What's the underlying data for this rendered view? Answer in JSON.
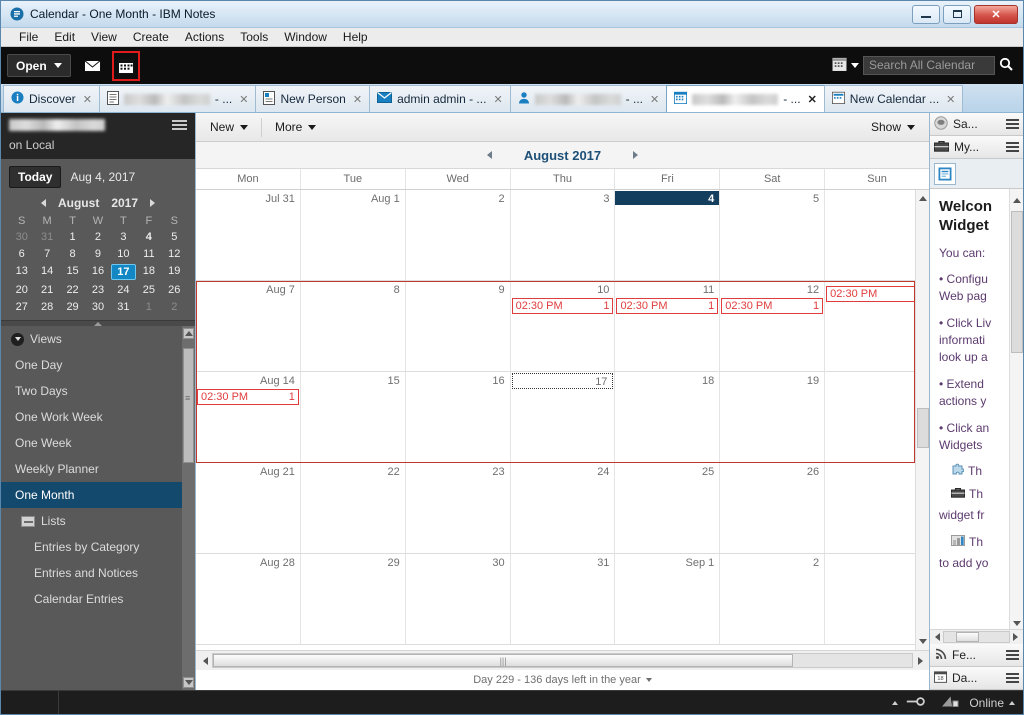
{
  "window": {
    "title": "Calendar - One Month - IBM Notes",
    "app_icon": "notes-logo-icon",
    "minimize_label": "Minimize",
    "maximize_label": "Maximize",
    "close_label": "✕"
  },
  "menubar": [
    "File",
    "Edit",
    "View",
    "Create",
    "Actions",
    "Tools",
    "Window",
    "Help"
  ],
  "toolbar": {
    "open_label": "Open",
    "mail_icon": "envelope-icon",
    "calendar_icon": "calendar-icon",
    "search_scope_icon": "calendar-icon",
    "search_placeholder": "Search All Calendar",
    "search_value": "",
    "search_icon": "magnifier-icon"
  },
  "tabs": [
    {
      "label": "Discover",
      "icon": "info-icon",
      "redacted": false,
      "active": false,
      "close": "✕"
    },
    {
      "label": "",
      "suffix": "- ...",
      "icon": "document-icon",
      "redacted": true,
      "active": false,
      "close": "✕"
    },
    {
      "label": "New Person",
      "icon": "person-document-icon",
      "redacted": false,
      "active": false,
      "close": "✕"
    },
    {
      "label": "admin admin - ...",
      "icon": "mail-icon",
      "redacted": false,
      "active": false,
      "close": "✕"
    },
    {
      "label": "",
      "suffix": "- ...",
      "icon": "contact-icon",
      "redacted": true,
      "active": false,
      "close": "✕"
    },
    {
      "label": "",
      "suffix": "- ...",
      "icon": "calendar-icon",
      "redacted": true,
      "active": true,
      "close": "✕"
    },
    {
      "label": "New Calendar ...",
      "icon": "calendar-icon",
      "redacted": false,
      "active": false,
      "close": "✕"
    }
  ],
  "leftnav": {
    "user_redacted": true,
    "server_label": "on Local",
    "menu_icon": "hamburger-icon",
    "today_button": "Today",
    "today_date": "Aug 4, 2017",
    "minical": {
      "prev_icon": "prev-arrow-icon",
      "next_icon": "next-arrow-icon",
      "month": "August",
      "year": "2017",
      "dow": [
        "S",
        "M",
        "T",
        "W",
        "T",
        "F",
        "S"
      ],
      "weeks": [
        [
          {
            "n": "30",
            "out": true
          },
          {
            "n": "31",
            "out": true
          },
          {
            "n": "1"
          },
          {
            "n": "2"
          },
          {
            "n": "3"
          },
          {
            "n": "4",
            "bold": true
          },
          {
            "n": "5"
          }
        ],
        [
          {
            "n": "6"
          },
          {
            "n": "7"
          },
          {
            "n": "8"
          },
          {
            "n": "9"
          },
          {
            "n": "10"
          },
          {
            "n": "11"
          },
          {
            "n": "12"
          }
        ],
        [
          {
            "n": "13"
          },
          {
            "n": "14"
          },
          {
            "n": "15"
          },
          {
            "n": "16"
          },
          {
            "n": "17",
            "sel": true
          },
          {
            "n": "18"
          },
          {
            "n": "19"
          }
        ],
        [
          {
            "n": "20"
          },
          {
            "n": "21"
          },
          {
            "n": "22"
          },
          {
            "n": "23"
          },
          {
            "n": "24"
          },
          {
            "n": "25"
          },
          {
            "n": "26"
          }
        ],
        [
          {
            "n": "27"
          },
          {
            "n": "28"
          },
          {
            "n": "29"
          },
          {
            "n": "30"
          },
          {
            "n": "31"
          },
          {
            "n": "1",
            "out": true
          },
          {
            "n": "2",
            "out": true
          }
        ]
      ]
    },
    "views_group": "Views",
    "views": [
      {
        "label": "One Day",
        "active": false,
        "kind": "item"
      },
      {
        "label": "Two Days",
        "active": false,
        "kind": "item"
      },
      {
        "label": "One Work Week",
        "active": false,
        "kind": "item"
      },
      {
        "label": "One Week",
        "active": false,
        "kind": "item"
      },
      {
        "label": "Weekly Planner",
        "active": false,
        "kind": "item"
      },
      {
        "label": "One Month",
        "active": true,
        "kind": "item"
      },
      {
        "label": "Lists",
        "active": false,
        "kind": "folder"
      },
      {
        "label": "Entries by Category",
        "active": false,
        "kind": "sub"
      },
      {
        "label": "Entries and Notices",
        "active": false,
        "kind": "sub"
      },
      {
        "label": "Calendar Entries",
        "active": false,
        "kind": "sub"
      }
    ]
  },
  "calendar": {
    "actions": {
      "new_label": "New",
      "more_label": "More",
      "show_label": "Show"
    },
    "month_title": "August 2017",
    "prev_icon": "prev-arrow-icon",
    "next_icon": "next-arrow-icon",
    "dow_headers": [
      "Mon",
      "Tue",
      "Wed",
      "Thu",
      "Fri",
      "Sat",
      "Sun"
    ],
    "weeks": [
      {
        "days": [
          {
            "num": "Jul 31",
            "today": false,
            "selected": false,
            "entries": []
          },
          {
            "num": "Aug 1",
            "today": false,
            "selected": false,
            "entries": []
          },
          {
            "num": "2",
            "today": false,
            "selected": false,
            "entries": []
          },
          {
            "num": "3",
            "today": false,
            "selected": false,
            "entries": []
          },
          {
            "num": "4",
            "today": true,
            "selected": false,
            "entries": []
          },
          {
            "num": "5",
            "today": false,
            "selected": false,
            "entries": []
          },
          {
            "num": "",
            "today": false,
            "selected": false,
            "entries": []
          }
        ]
      },
      {
        "days": [
          {
            "num": "Aug 7",
            "today": false,
            "selected": false,
            "entries": []
          },
          {
            "num": "8",
            "today": false,
            "selected": false,
            "entries": []
          },
          {
            "num": "9",
            "today": false,
            "selected": false,
            "entries": []
          },
          {
            "num": "10",
            "today": false,
            "selected": false,
            "entries": [
              {
                "time": "02:30 PM",
                "count": "1"
              }
            ]
          },
          {
            "num": "11",
            "today": false,
            "selected": false,
            "entries": [
              {
                "time": "02:30 PM",
                "count": "1"
              }
            ]
          },
          {
            "num": "12",
            "today": false,
            "selected": false,
            "entries": [
              {
                "time": "02:30 PM",
                "count": "1"
              }
            ]
          },
          {
            "num": "",
            "today": false,
            "selected": false,
            "entries": [
              {
                "time": "02:30 PM",
                "count": ""
              }
            ]
          }
        ]
      },
      {
        "days": [
          {
            "num": "Aug 14",
            "today": false,
            "selected": false,
            "entries": [
              {
                "time": "02:30 PM",
                "count": "1"
              }
            ]
          },
          {
            "num": "15",
            "today": false,
            "selected": false,
            "entries": []
          },
          {
            "num": "16",
            "today": false,
            "selected": false,
            "entries": []
          },
          {
            "num": "17",
            "today": false,
            "selected": true,
            "entries": []
          },
          {
            "num": "18",
            "today": false,
            "selected": false,
            "entries": []
          },
          {
            "num": "19",
            "today": false,
            "selected": false,
            "entries": []
          },
          {
            "num": "",
            "today": false,
            "selected": false,
            "entries": []
          }
        ]
      },
      {
        "days": [
          {
            "num": "Aug 21",
            "today": false,
            "selected": false,
            "entries": []
          },
          {
            "num": "22",
            "today": false,
            "selected": false,
            "entries": []
          },
          {
            "num": "23",
            "today": false,
            "selected": false,
            "entries": []
          },
          {
            "num": "24",
            "today": false,
            "selected": false,
            "entries": []
          },
          {
            "num": "25",
            "today": false,
            "selected": false,
            "entries": []
          },
          {
            "num": "26",
            "today": false,
            "selected": false,
            "entries": []
          },
          {
            "num": "",
            "today": false,
            "selected": false,
            "entries": []
          }
        ]
      },
      {
        "days": [
          {
            "num": "Aug 28",
            "today": false,
            "selected": false,
            "entries": []
          },
          {
            "num": "29",
            "today": false,
            "selected": false,
            "entries": []
          },
          {
            "num": "30",
            "today": false,
            "selected": false,
            "entries": []
          },
          {
            "num": "31",
            "today": false,
            "selected": false,
            "entries": []
          },
          {
            "num": "Sep 1",
            "today": false,
            "selected": false,
            "entries": []
          },
          {
            "num": "2",
            "today": false,
            "selected": false,
            "entries": []
          },
          {
            "num": "",
            "today": false,
            "selected": false,
            "entries": []
          }
        ]
      }
    ],
    "day_status": "Day 229 - 136 days left in the year"
  },
  "rightbar": {
    "panels_top": [
      {
        "label": "Sa...",
        "icon": "sametime-icon"
      },
      {
        "label": "My...",
        "icon": "briefcase-icon"
      }
    ],
    "panels_bottom": [
      {
        "label": "Fe...",
        "icon": "rss-feed-icon"
      },
      {
        "label": "Da...",
        "icon": "day-planner-icon"
      }
    ],
    "widget_tab_icon": "widget-icon",
    "content": {
      "heading_line1": "Welcon",
      "heading_line2": "Widget",
      "intro": "You can:",
      "bullets": [
        "• Configu\nWeb pag",
        "• Click Liv\ninformati\nlook up a",
        "• Extend \nactions y",
        "• Click an\nWidgets "
      ],
      "sub_items": [
        {
          "icon": "puzzle-icon",
          "text": "Th"
        },
        {
          "icon": "toolbox-icon",
          "text": "Th"
        },
        {
          "icon": "chart-icon",
          "text": "Th"
        }
      ],
      "trailing": "widget fr",
      "trailing2": "to add yo"
    }
  },
  "statusbar": {
    "key_icon": "key-icon",
    "network_icon": "network-icon",
    "online_label": "Online"
  },
  "colors": {
    "accent": "#1d4f77",
    "today_bg": "#133e5e",
    "entry_red": "#e03c3c",
    "selection_red": "#c0392b",
    "highlight_red": "#e01b1b",
    "nav_bg": "#595959",
    "nav_active": "#14496e"
  }
}
